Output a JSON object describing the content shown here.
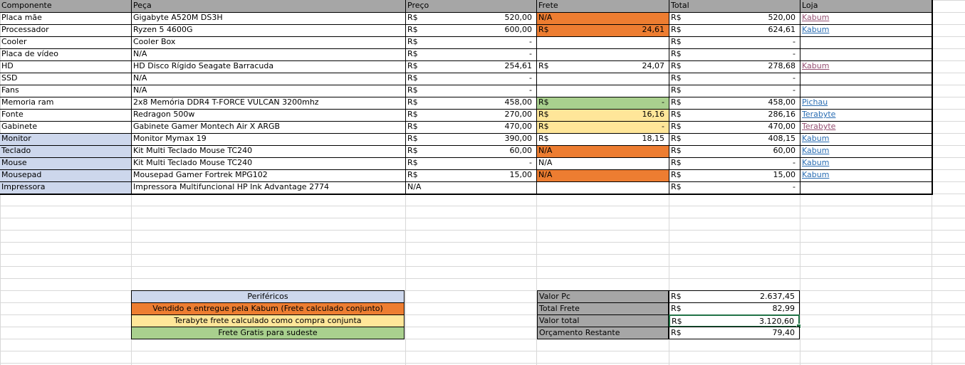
{
  "headers": [
    "Componente",
    "Peça",
    "Preço",
    "Frete",
    "Total",
    "Loja"
  ],
  "currency": "R$",
  "rows": [
    {
      "comp": "Placa mãe",
      "peca": "Gigabyte A520M DS3H",
      "preco": "520,00",
      "frete_cur": "",
      "frete": "N/A",
      "total": "520,00",
      "loja": "Kabum",
      "frete_color": "orange",
      "comp_color": "",
      "loja_visited": true
    },
    {
      "comp": "Processador",
      "peca": "Ryzen 5 4600G",
      "preco": "600,00",
      "frete_cur": "R$",
      "frete": "24,61",
      "total": "624,61",
      "loja": "Kabum",
      "frete_color": "orange",
      "comp_color": "",
      "loja_visited": false
    },
    {
      "comp": "Cooler",
      "peca": "Cooler Box",
      "preco": "-",
      "frete_cur": "",
      "frete": "",
      "total": "-",
      "loja": "",
      "frete_color": "",
      "comp_color": ""
    },
    {
      "comp": "Placa de vídeo",
      "peca": "N/A",
      "preco": "-",
      "frete_cur": "",
      "frete": "",
      "total": "-",
      "loja": "",
      "frete_color": "",
      "comp_color": ""
    },
    {
      "comp": "HD",
      "peca": "HD Disco Rígido Seagate Barracuda",
      "preco": "254,61",
      "frete_cur": "R$",
      "frete": "24,07",
      "total": "278,68",
      "loja": "Kabum",
      "frete_color": "",
      "comp_color": "",
      "loja_visited": true
    },
    {
      "comp": "SSD",
      "peca": "N/A",
      "preco": "-",
      "frete_cur": "",
      "frete": "",
      "total": "-",
      "loja": "",
      "frete_color": "",
      "comp_color": ""
    },
    {
      "comp": "Fans",
      "peca": "N/A",
      "preco": "-",
      "frete_cur": "",
      "frete": "",
      "total": "-",
      "loja": "",
      "frete_color": "",
      "comp_color": ""
    },
    {
      "comp": "Memoria ram",
      "peca": "2x8 Memória DDR4 T-FORCE VULCAN 3200mhz",
      "preco": "458,00",
      "frete_cur": "R$",
      "frete": "-",
      "total": "458,00",
      "loja": "Pichau",
      "frete_color": "green",
      "comp_color": "",
      "loja_visited": false
    },
    {
      "comp": "Fonte",
      "peca": "Redragon 500w",
      "preco": "270,00",
      "frete_cur": "R$",
      "frete": "16,16",
      "total": "286,16",
      "loja": "Terabyte",
      "frete_color": "yellow",
      "comp_color": "",
      "loja_visited": false
    },
    {
      "comp": "Gabinete",
      "peca": "Gabinete Gamer Montech Air X ARGB",
      "preco": "470,00",
      "frete_cur": "R$",
      "frete": "-",
      "total": "470,00",
      "loja": "Terabyte",
      "frete_color": "yellow",
      "comp_color": "",
      "loja_visited": true
    },
    {
      "comp": "Monitor",
      "peca": "Monitor Mymax 19",
      "preco": "390,00",
      "frete_cur": "R$",
      "frete": "18,15",
      "total": "408,15",
      "loja": "Kabum",
      "frete_color": "",
      "comp_color": "blue",
      "loja_visited": false
    },
    {
      "comp": "Teclado",
      "peca": "Kit Multi Teclado Mouse TC240",
      "preco": "60,00",
      "frete_cur": "",
      "frete": "N/A",
      "total": "60,00",
      "loja": "Kabum",
      "frete_color": "orange",
      "comp_color": "blue",
      "loja_visited": false
    },
    {
      "comp": "Mouse",
      "peca": "Kit Multi Teclado Mouse TC240",
      "preco": "-",
      "frete_cur": "",
      "frete": "N/A",
      "total": "-",
      "loja": "Kabum",
      "frete_color": "",
      "comp_color": "blue",
      "loja_visited": false
    },
    {
      "comp": "Mousepad",
      "peca": "Mousepad Gamer Fortrek MPG102",
      "preco": "15,00",
      "frete_cur": "",
      "frete": "N/A",
      "total": "15,00",
      "loja": "Kabum",
      "frete_color": "orange",
      "comp_color": "blue",
      "loja_visited": false
    },
    {
      "comp": "Impressora",
      "peca": "Impressora Multifuncional HP Ink Advantage 2774",
      "preco": "N/A",
      "preco_no_cur": true,
      "frete_cur": "",
      "frete": "",
      "total": "-",
      "loja": "",
      "frete_color": "",
      "comp_color": "blue"
    }
  ],
  "legend": [
    {
      "text": "Periféricos",
      "color": "blue"
    },
    {
      "text": "Vendido e entregue pela Kabum (Frete calculado conjunto)",
      "color": "orange"
    },
    {
      "text": "Terabyte frete calculado como compra conjunta",
      "color": "yellow"
    },
    {
      "text": "Frete Gratis para sudeste",
      "color": "green"
    }
  ],
  "summary": [
    {
      "label": "Valor Pc",
      "value": "2.637,45"
    },
    {
      "label": "Total Frete",
      "value": "82,99"
    },
    {
      "label": "Valor total",
      "value": "3.120,60",
      "selected": true
    },
    {
      "label": "Orçamento Restante",
      "value": "79,40"
    }
  ],
  "colors": {
    "orange": "#ed7d31",
    "yellow": "#ffe699",
    "green": "#a9d08e",
    "blue": "#cdd7ec",
    "grey": "#a6a6a6",
    "selection": "#217346"
  }
}
